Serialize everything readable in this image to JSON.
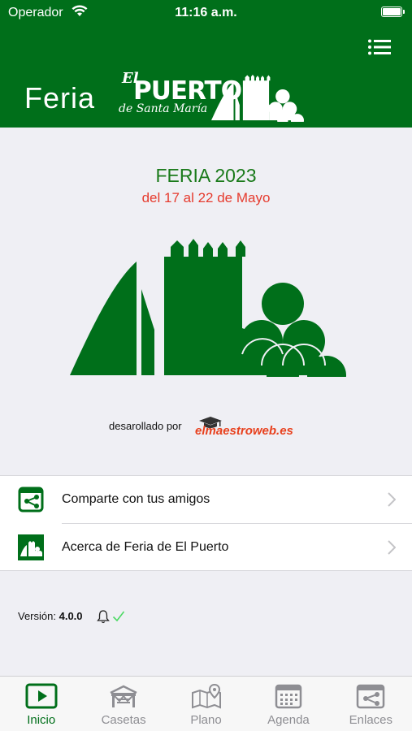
{
  "status_bar": {
    "carrier": "Operador",
    "time": "11:16 a.m."
  },
  "header": {
    "logo_feria": "Feria",
    "logo_el": "El",
    "logo_puerto": "PUERTO",
    "logo_santa_maria": "de Santa María"
  },
  "event": {
    "title": "FERIA 2023",
    "dates": "del 17 al 22 de Mayo"
  },
  "developer": {
    "prefix": "desarollado por",
    "brand": "elmaestroweb.es"
  },
  "list": [
    {
      "label": "Comparte con tus amigos",
      "icon": "share-icon"
    },
    {
      "label": "Acerca de Feria de El Puerto",
      "icon": "info-logo-icon"
    }
  ],
  "version": {
    "label": "Versión:",
    "value": "4.0.0"
  },
  "tabbar": [
    {
      "label": "Inicio",
      "icon": "play-icon",
      "active": true
    },
    {
      "label": "Casetas",
      "icon": "caseta-icon",
      "active": false
    },
    {
      "label": "Plano",
      "icon": "map-icon",
      "active": false
    },
    {
      "label": "Agenda",
      "icon": "calendar-icon",
      "active": false
    },
    {
      "label": "Enlaces",
      "icon": "links-icon",
      "active": false
    }
  ],
  "colors": {
    "brand_green": "#006f1a",
    "title_green": "#1a7a1a",
    "date_red": "#e63b2e",
    "tab_inactive": "#8e8e93"
  }
}
